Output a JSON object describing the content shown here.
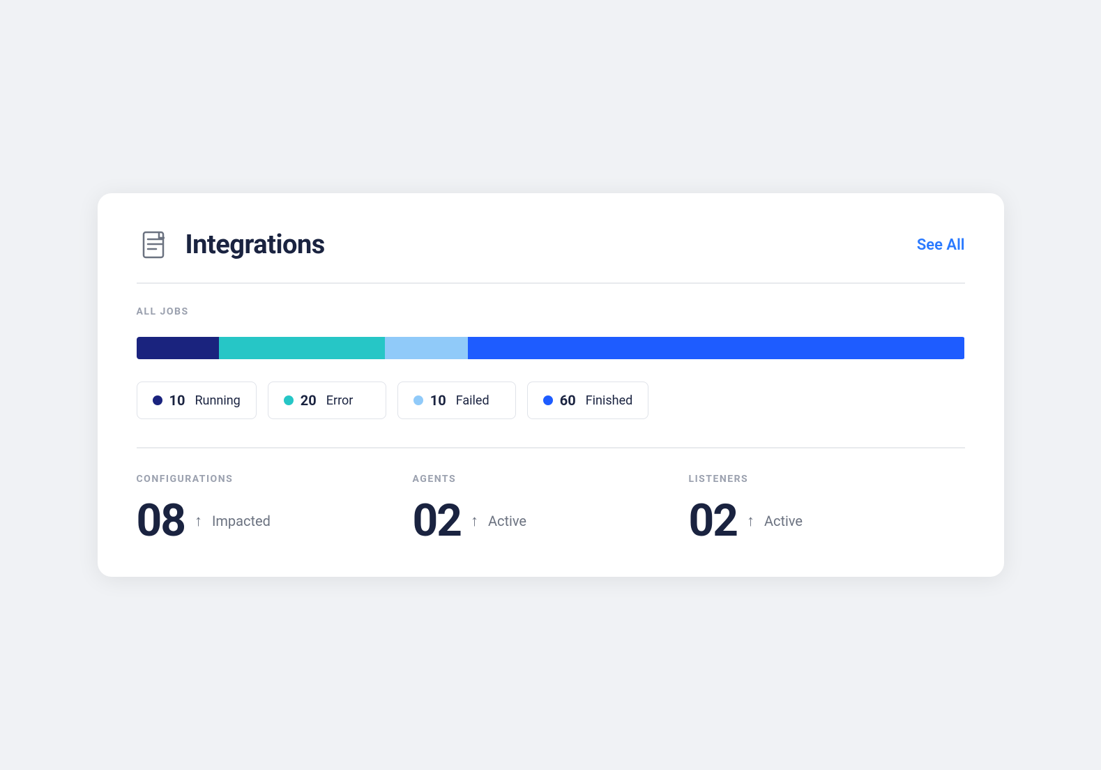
{
  "header": {
    "icon_label": "document-icon",
    "title": "Integrations",
    "see_all_label": "See All"
  },
  "all_jobs_section": {
    "label": "ALL JOBS",
    "progress_segments": [
      {
        "id": "running",
        "color": "#1a237e",
        "width_pct": 10
      },
      {
        "id": "error",
        "color": "#26c6c6",
        "width_pct": 20
      },
      {
        "id": "failed",
        "color": "#90caf9",
        "width_pct": 10
      },
      {
        "id": "finished",
        "color": "#1e5cff",
        "width_pct": 60
      }
    ],
    "legend": [
      {
        "id": "running",
        "dot_color": "#1a237e",
        "count": "10",
        "label": "Running"
      },
      {
        "id": "error",
        "dot_color": "#26c6c6",
        "count": "20",
        "label": "Error"
      },
      {
        "id": "failed",
        "dot_color": "#90caf9",
        "count": "10",
        "label": "Failed"
      },
      {
        "id": "finished",
        "dot_color": "#1e5cff",
        "count": "60",
        "label": "Finished"
      }
    ]
  },
  "stats": [
    {
      "id": "configurations",
      "label": "CONFIGURATIONS",
      "number": "08",
      "arrow": "↑",
      "text": "Impacted"
    },
    {
      "id": "agents",
      "label": "AGENTS",
      "number": "02",
      "arrow": "↑",
      "text": "Active"
    },
    {
      "id": "listeners",
      "label": "LISTENERS",
      "number": "02",
      "arrow": "↑",
      "text": "Active"
    }
  ]
}
